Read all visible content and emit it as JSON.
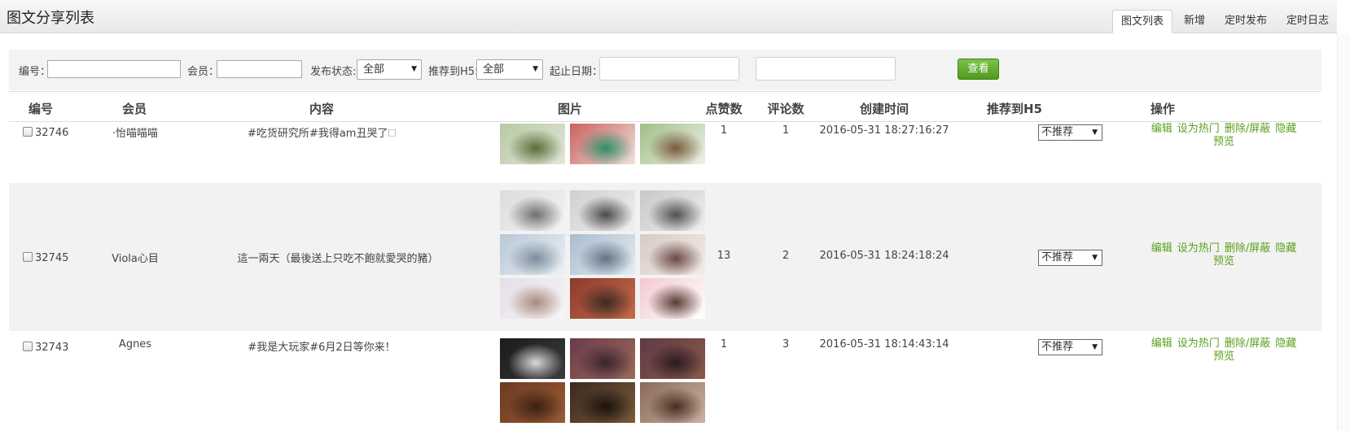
{
  "header": {
    "title": "图文分享列表",
    "tabs": [
      {
        "label": "图文列表",
        "active": true
      },
      {
        "label": "新增"
      },
      {
        "label": "定时发布"
      },
      {
        "label": "定时日志"
      }
    ]
  },
  "filters": {
    "id_label": "编号：",
    "member_label": "会员：",
    "status_label": "发布状态:",
    "status_value": "全部",
    "h5_label": "推荐到H5:",
    "h5_value": "全部",
    "date_label": "起止日期：",
    "date_sep": "—",
    "view_button": "查看"
  },
  "columns": [
    "编号",
    "会员",
    "内容",
    "图片",
    "点赞数",
    "评论数",
    "创建时间",
    "推荐到H5",
    "操作"
  ],
  "actions": {
    "edit": "编辑",
    "hot": "设为热门",
    "delete": "删除/屏蔽",
    "hide": "隐藏",
    "preview": "预览"
  },
  "rows": [
    {
      "id": "32746",
      "member": "·怡喵喵喵",
      "content": "#吃货研究所#我得am丑哭了🗆",
      "likes": "1",
      "comments": "1",
      "created": "2016-05-31 18:27:16:27",
      "h5": "不推荐",
      "images": [
        {
          "c1": "#b8c9a4",
          "c2": "#e2e6d8",
          "c3": "#5a6e3a"
        },
        {
          "c1": "#c9615e",
          "c2": "#efe3dc",
          "c3": "#2f8f6a"
        },
        {
          "c1": "#9fbf86",
          "c2": "#eef0e8",
          "c3": "#7a5b3d"
        }
      ]
    },
    {
      "id": "32745",
      "member": "Viola心目",
      "content": "這一兩天（最後送上只吃不飽就愛哭的豬）",
      "likes": "13",
      "comments": "2",
      "created": "2016-05-31 18:24:18:24",
      "h5": "不推荐",
      "images": [
        {
          "c1": "#dcdcdc",
          "c2": "#f4f4f4",
          "c3": "#6f6f6f"
        },
        {
          "c1": "#cfcfcf",
          "c2": "#f0f0f0",
          "c3": "#4a4a4a"
        },
        {
          "c1": "#c8c8c8",
          "c2": "#efefef",
          "c3": "#505050"
        },
        {
          "c1": "#b7c6d6",
          "c2": "#eef2f6",
          "c3": "#7d8ea0"
        },
        {
          "c1": "#a9bccc",
          "c2": "#e7edf2",
          "c3": "#607486"
        },
        {
          "c1": "#d9c9c6",
          "c2": "#f3ece9",
          "c3": "#6a4a44"
        },
        {
          "c1": "#e6dde8",
          "c2": "#f7f4f8",
          "c3": "#a68c7a"
        },
        {
          "c1": "#8a3b30",
          "c2": "#c66a4a",
          "c3": "#3a2a22"
        },
        {
          "c1": "#f2c9d0",
          "c2": "#ffffff",
          "c3": "#5a3a34"
        }
      ]
    },
    {
      "id": "32743",
      "member": "Agnes",
      "content": "#我是大玩家#6月2日等你来！",
      "likes": "1",
      "comments": "3",
      "created": "2016-05-31 18:14:43:14",
      "h5": "不推荐",
      "images": [
        {
          "c1": "#1b1b1b",
          "c2": "#3a3a3a",
          "c3": "#d9d9d9"
        },
        {
          "c1": "#6a3b4a",
          "c2": "#9c6a5a",
          "c3": "#3a2330"
        },
        {
          "c1": "#5e3a44",
          "c2": "#8a5a4a",
          "c3": "#2a1a20"
        },
        {
          "c1": "#6b3a22",
          "c2": "#9a5a34",
          "c3": "#3a2012"
        },
        {
          "c1": "#3a2a1e",
          "c2": "#7a5a3a",
          "c3": "#1a120c"
        },
        {
          "c1": "#8a6a5a",
          "c2": "#c9b2a2",
          "c3": "#4a2e22"
        }
      ]
    }
  ]
}
